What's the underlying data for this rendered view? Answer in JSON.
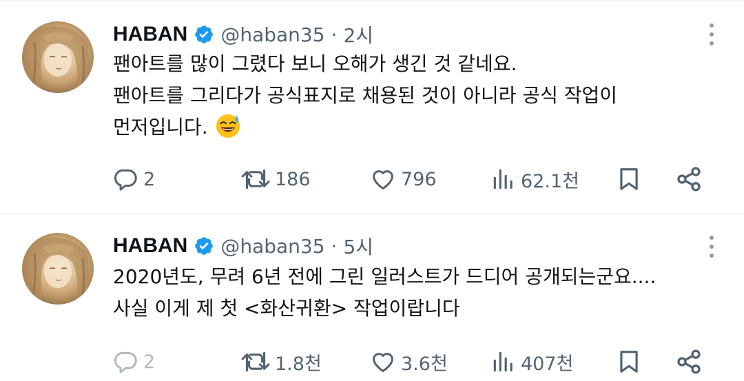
{
  "tweets": [
    {
      "author_name": "HABAN",
      "handle": "@haban35",
      "separator": "·",
      "time": "2시",
      "lines": [
        "팬아트를 많이 그렸다 보니 오해가 생긴 것 같네요.",
        "팬아트를 그리다가 공식표지로 채용된 것이 아니라 공식 작업이",
        "먼저입니다."
      ],
      "emoji": "sweat-smile-emoji",
      "replies": "2",
      "retweets": "186",
      "likes": "796",
      "views": "62.1천"
    },
    {
      "author_name": "HABAN",
      "handle": "@haban35",
      "separator": "·",
      "time": "5시",
      "lines": [
        "2020년도, 무려 6년 전에 그린 일러스트가 드디어 공개되는군요....",
        "사실 이게 제 첫 <화산귀환> 작업이랍니다"
      ],
      "replies": "2",
      "retweets": "1.8천",
      "likes": "3.6천",
      "views": "407천"
    }
  ],
  "icons": {
    "reply": "reply-icon",
    "retweet": "retweet-icon",
    "like": "heart-icon",
    "views": "views-chart-icon",
    "bookmark": "bookmark-icon",
    "share": "share-icon",
    "verified": "verified-badge-icon",
    "more": "more-options-icon"
  },
  "colors": {
    "text": "#0f1419",
    "secondary": "#536471",
    "verified": "#1d9bf0",
    "divider": "#e3e7ea"
  }
}
